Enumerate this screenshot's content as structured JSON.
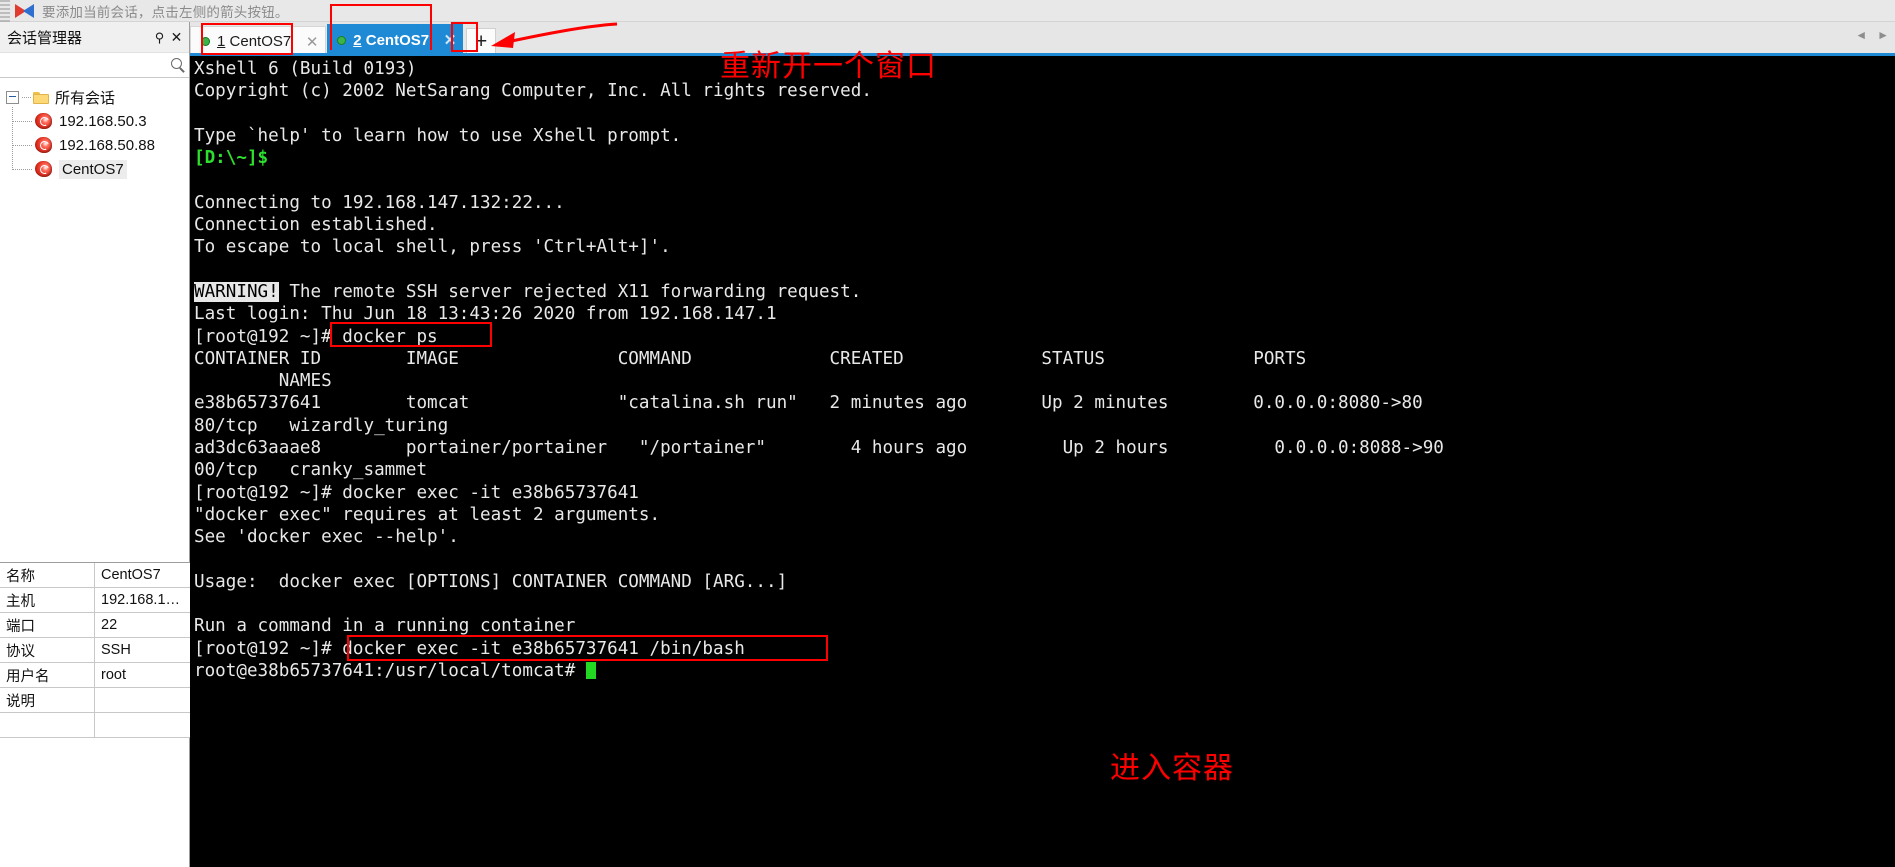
{
  "notice": {
    "text": "要添加当前会话，点击左侧的箭头按钮。",
    "flag_icon": "flag-icon"
  },
  "session_panel": {
    "title": "会话管理器",
    "pin_glyph": "⚲",
    "close_glyph": "✕",
    "search_placeholder": "",
    "search_value": "",
    "search_icon": "search-icon",
    "tree": {
      "root_label": "所有会话",
      "items": [
        {
          "label": "192.168.50.3",
          "selected": false
        },
        {
          "label": "192.168.50.88",
          "selected": false
        },
        {
          "label": "CentOS7",
          "selected": true
        }
      ]
    },
    "properties": [
      {
        "key": "名称",
        "value": "CentOS7"
      },
      {
        "key": "主机",
        "value": "192.168.1…"
      },
      {
        "key": "端口",
        "value": "22"
      },
      {
        "key": "协议",
        "value": "SSH"
      },
      {
        "key": "用户名",
        "value": "root"
      },
      {
        "key": "说明",
        "value": ""
      },
      {
        "key": "",
        "value": ""
      }
    ]
  },
  "tabs": {
    "items": [
      {
        "num": "1",
        "label": "CentOS7",
        "active": false,
        "close_glyph": "✕"
      },
      {
        "num": "2",
        "label": "CentOS7",
        "active": true,
        "close_glyph": "✕"
      }
    ],
    "add_label": "+",
    "scroll_left": "◄",
    "scroll_right": "►"
  },
  "terminal": {
    "lines": [
      {
        "segs": [
          {
            "t": "Xshell 6 (Build 0193)"
          }
        ]
      },
      {
        "segs": [
          {
            "t": "Copyright (c) 2002 NetSarang Computer, Inc. All rights reserved."
          }
        ]
      },
      {
        "segs": [
          {
            "t": ""
          }
        ]
      },
      {
        "segs": [
          {
            "t": "Type `help' to learn how to use Xshell prompt."
          }
        ]
      },
      {
        "segs": [
          {
            "t": "[D:\\~]$",
            "c": "t-green"
          }
        ]
      },
      {
        "segs": [
          {
            "t": ""
          }
        ]
      },
      {
        "segs": [
          {
            "t": "Connecting to 192.168.147.132:22..."
          }
        ]
      },
      {
        "segs": [
          {
            "t": "Connection established."
          }
        ]
      },
      {
        "segs": [
          {
            "t": "To escape to local shell, press 'Ctrl+Alt+]'."
          }
        ]
      },
      {
        "segs": [
          {
            "t": ""
          }
        ]
      },
      {
        "segs": [
          {
            "t": "WARNING!",
            "c": "t-inverse"
          },
          {
            "t": " The remote SSH server rejected X11 forwarding request."
          }
        ]
      },
      {
        "segs": [
          {
            "t": "Last login: Thu Jun 18 13:43:26 2020 from 192.168.147.1"
          }
        ]
      },
      {
        "segs": [
          {
            "t": "[root@192 ~]# docker ps"
          }
        ]
      },
      {
        "segs": [
          {
            "t": "CONTAINER ID        IMAGE               COMMAND             CREATED             STATUS              PORTS"
          }
        ]
      },
      {
        "segs": [
          {
            "t": "        NAMES"
          }
        ]
      },
      {
        "segs": [
          {
            "t": "e38b65737641        tomcat              \"catalina.sh run\"   2 minutes ago       Up 2 minutes        0.0.0.0:8080->80"
          }
        ]
      },
      {
        "segs": [
          {
            "t": "80/tcp   wizardly_turing"
          }
        ]
      },
      {
        "segs": [
          {
            "t": "ad3dc63aaae8        portainer/portainer   \"/portainer\"        4 hours ago         Up 2 hours          0.0.0.0:8088->90"
          }
        ]
      },
      {
        "segs": [
          {
            "t": "00/tcp   cranky_sammet"
          }
        ]
      },
      {
        "segs": [
          {
            "t": "[root@192 ~]# docker exec -it e38b65737641"
          }
        ]
      },
      {
        "segs": [
          {
            "t": "\"docker exec\" requires at least 2 arguments."
          }
        ]
      },
      {
        "segs": [
          {
            "t": "See 'docker exec --help'."
          }
        ]
      },
      {
        "segs": [
          {
            "t": ""
          }
        ]
      },
      {
        "segs": [
          {
            "t": "Usage:  docker exec [OPTIONS] CONTAINER COMMAND [ARG...]"
          }
        ]
      },
      {
        "segs": [
          {
            "t": ""
          }
        ]
      },
      {
        "segs": [
          {
            "t": "Run a command in a running container"
          }
        ]
      },
      {
        "segs": [
          {
            "t": "[root@192 ~]# docker exec -it e38b65737641 /bin/bash"
          }
        ]
      },
      {
        "segs": [
          {
            "t": "root@e38b65737641:/usr/local/tomcat# "
          },
          {
            "t": "",
            "cursor": true
          }
        ]
      }
    ]
  },
  "annotations": {
    "new_window_note": "重新开一个窗口",
    "enter_container_note": "进入容器",
    "accent_red": "#ff0000",
    "accent_blue": "#1e8ad6",
    "accent_green": "#22d822"
  }
}
